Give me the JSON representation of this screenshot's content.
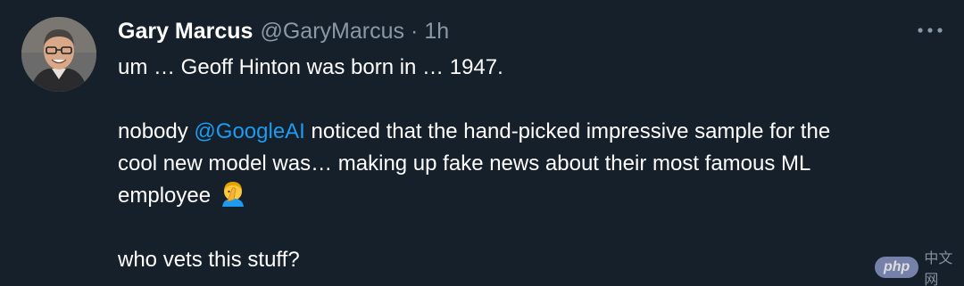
{
  "tweet": {
    "author": {
      "display_name": "Gary Marcus",
      "handle": "@GaryMarcus",
      "separator": "·",
      "time": "1h"
    },
    "more_icon": "more-horizontal-icon",
    "text": {
      "line1": "um … Geoff Hinton was born in … 1947.",
      "line2_prefix": "nobody ",
      "mention": "@GoogleAI",
      "line2_suffix": " noticed that the hand-picked impressive sample for the",
      "line3": "cool new model was… making up fake news about their most famous ML",
      "line4": "employee",
      "emoji": "man-facepalming-emoji",
      "line5": "who vets this stuff?"
    }
  },
  "watermark": {
    "badge": "php",
    "text": "中文网"
  },
  "colors": {
    "background": "#15202b",
    "text": "#ffffff",
    "secondary": "#8b98a5",
    "link": "#1d9bf0"
  }
}
